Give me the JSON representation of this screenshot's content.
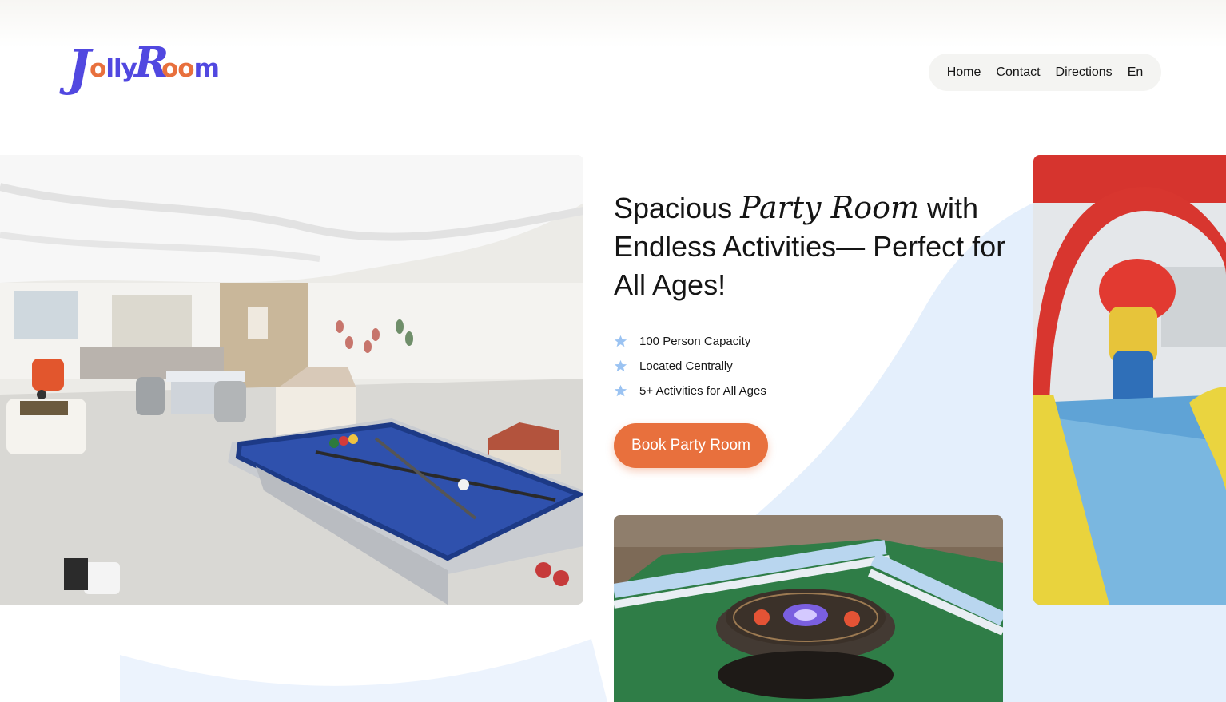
{
  "brand": {
    "logo_text": "Jolly Room",
    "colors": {
      "primary": "#5148e0",
      "accent": "#e8703d",
      "wave": "#dbe9fb"
    }
  },
  "nav": {
    "items": [
      {
        "label": "Home"
      },
      {
        "label": "Contact"
      },
      {
        "label": "Directions"
      },
      {
        "label": "En"
      }
    ]
  },
  "hero": {
    "title_part1": "Spacious ",
    "title_script": "Party Room",
    "title_part2": " with Endless Activities— Perfect for All Ages!",
    "features": [
      {
        "icon": "star-icon",
        "label": "100 Person Capacity"
      },
      {
        "icon": "star-icon",
        "label": "Located Centrally"
      },
      {
        "icon": "star-icon",
        "label": "5+ Activities for All Ages"
      }
    ],
    "cta_label": "Book Party Room"
  },
  "images": [
    {
      "name": "party-room-pool-table-photo"
    },
    {
      "name": "bouncy-castle-photo"
    },
    {
      "name": "mahjong-table-photo"
    }
  ]
}
